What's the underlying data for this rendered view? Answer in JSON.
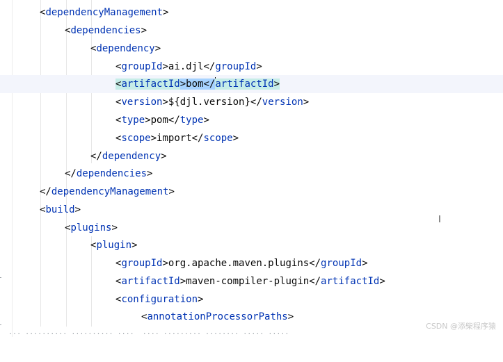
{
  "editor": {
    "lines": [
      {
        "open": "<",
        "tag": "dependencyManagement",
        "close": ">"
      },
      {
        "open": "<",
        "tag": "dependencies",
        "close": ">"
      },
      {
        "open": "<",
        "tag": "dependency",
        "close": ">"
      },
      {
        "open": "<",
        "tag": "groupId",
        "mid": ">",
        "text": "ai.djl",
        "open2": "</",
        "tag2": "groupId",
        "close": ">"
      },
      {
        "open": "<",
        "tag": "artifactId",
        "mid": ">",
        "text": "bom",
        "open2": "</",
        "tag2": "artifactId",
        "close": ">"
      },
      {
        "open": "<",
        "tag": "version",
        "mid": ">",
        "text": "${djl.version}",
        "open2": "</",
        "tag2": "version",
        "close": ">"
      },
      {
        "open": "<",
        "tag": "type",
        "mid": ">",
        "text": "pom",
        "open2": "</",
        "tag2": "type",
        "close": ">"
      },
      {
        "open": "<",
        "tag": "scope",
        "mid": ">",
        "text": "import",
        "open2": "</",
        "tag2": "scope",
        "close": ">"
      },
      {
        "open": "</",
        "tag": "dependency",
        "close": ">"
      },
      {
        "open": "</",
        "tag": "dependencies",
        "close": ">"
      },
      {
        "open": "</",
        "tag": "dependencyManagement",
        "close": ">"
      },
      {
        "open": "<",
        "tag": "build",
        "close": ">"
      },
      {
        "open": "<",
        "tag": "plugins",
        "close": ">"
      },
      {
        "open": "<",
        "tag": "plugin",
        "close": ">"
      },
      {
        "open": "<",
        "tag": "groupId",
        "mid": ">",
        "text": "org.apache.maven.plugins",
        "open2": "</",
        "tag2": "groupId",
        "close": ">"
      },
      {
        "open": "<",
        "tag": "artifactId",
        "mid": ">",
        "text": "maven-compiler-plugin",
        "open2": "</",
        "tag2": "artifactId",
        "close": ">"
      },
      {
        "open": "<",
        "tag": "configuration",
        "close": ">"
      },
      {
        "open": "<",
        "tag": "annotationProcessorPaths",
        "close": ">"
      }
    ]
  },
  "watermark": "CSDN @添柴程序猿"
}
